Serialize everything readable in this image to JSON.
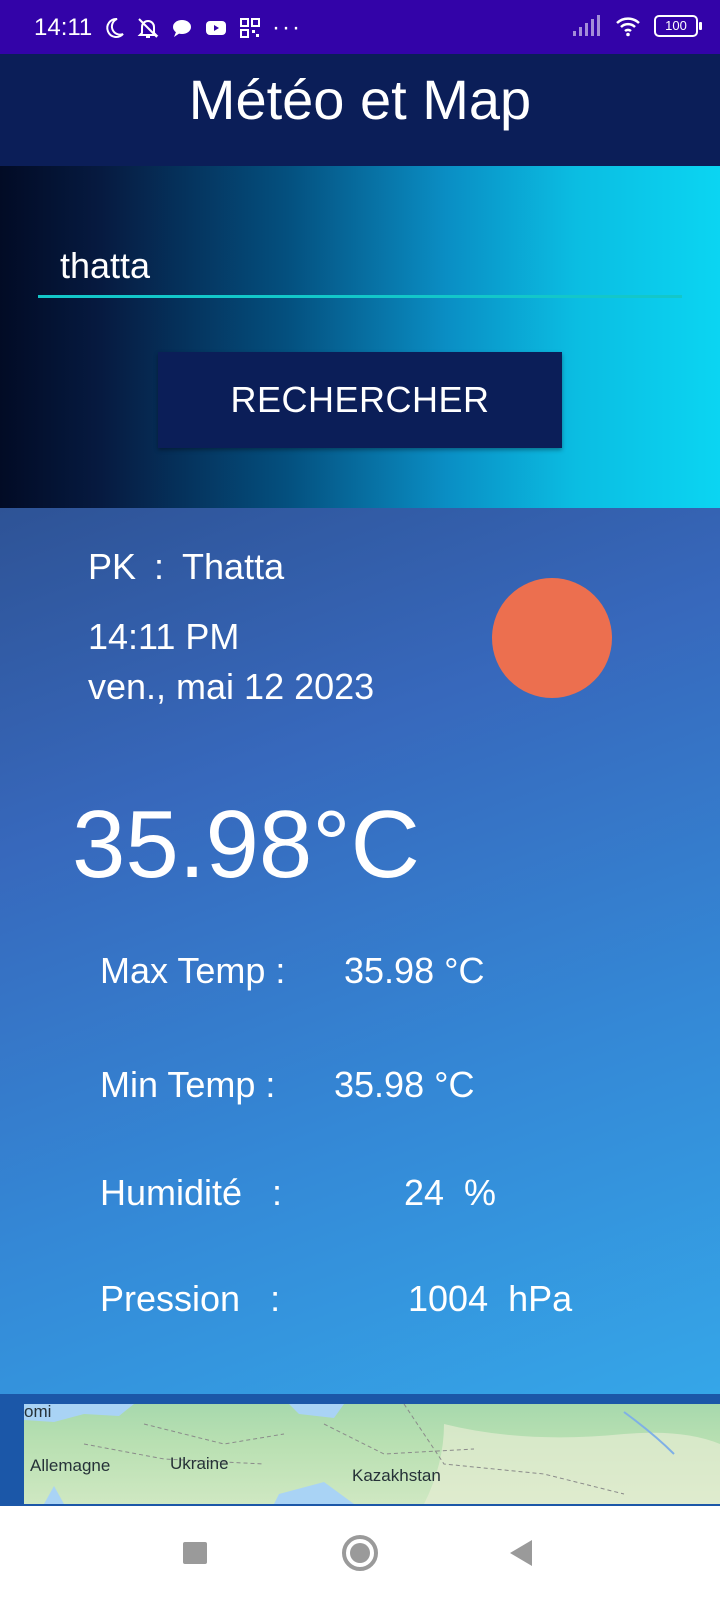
{
  "status_bar": {
    "time": "14:11",
    "battery": "100",
    "left_icons": [
      "moon-icon",
      "bell-off-icon",
      "chat-bubble-icon",
      "youtube-icon",
      "qr-grid-icon",
      "more-dots-icon"
    ],
    "right_icons": [
      "signal-icon",
      "wifi-icon",
      "battery-icon"
    ],
    "more": "···"
  },
  "app_bar": {
    "title": "Météo et Map",
    "color": "#0b1e58"
  },
  "search": {
    "input_value": "thatta",
    "button_label": "RECHERCHER",
    "underline_color": "#13c7c9"
  },
  "weather": {
    "country": "PK",
    "separator": ":",
    "city": "Thatta",
    "time": "14:11 PM",
    "date": "ven., mai 12 2023",
    "icon": "sun-icon",
    "icon_color": "#ec6f4f",
    "temperature": "35.98°C",
    "stats": [
      {
        "label": "Max Temp :",
        "value": "35.98 °C"
      },
      {
        "label": "Min Temp :",
        "value": "35.98 °C"
      },
      {
        "label": "Humidité   :",
        "value": "24  %"
      },
      {
        "label": "Pression   :",
        "value": "1004  hPa"
      }
    ]
  },
  "map": {
    "labels": [
      "Allemagne",
      "Ukraine",
      "Kazakhstan"
    ],
    "partial_label": "omi"
  },
  "nav_bar": {
    "buttons": [
      "recents-square-icon",
      "home-circle-icon",
      "back-triangle-icon"
    ]
  }
}
